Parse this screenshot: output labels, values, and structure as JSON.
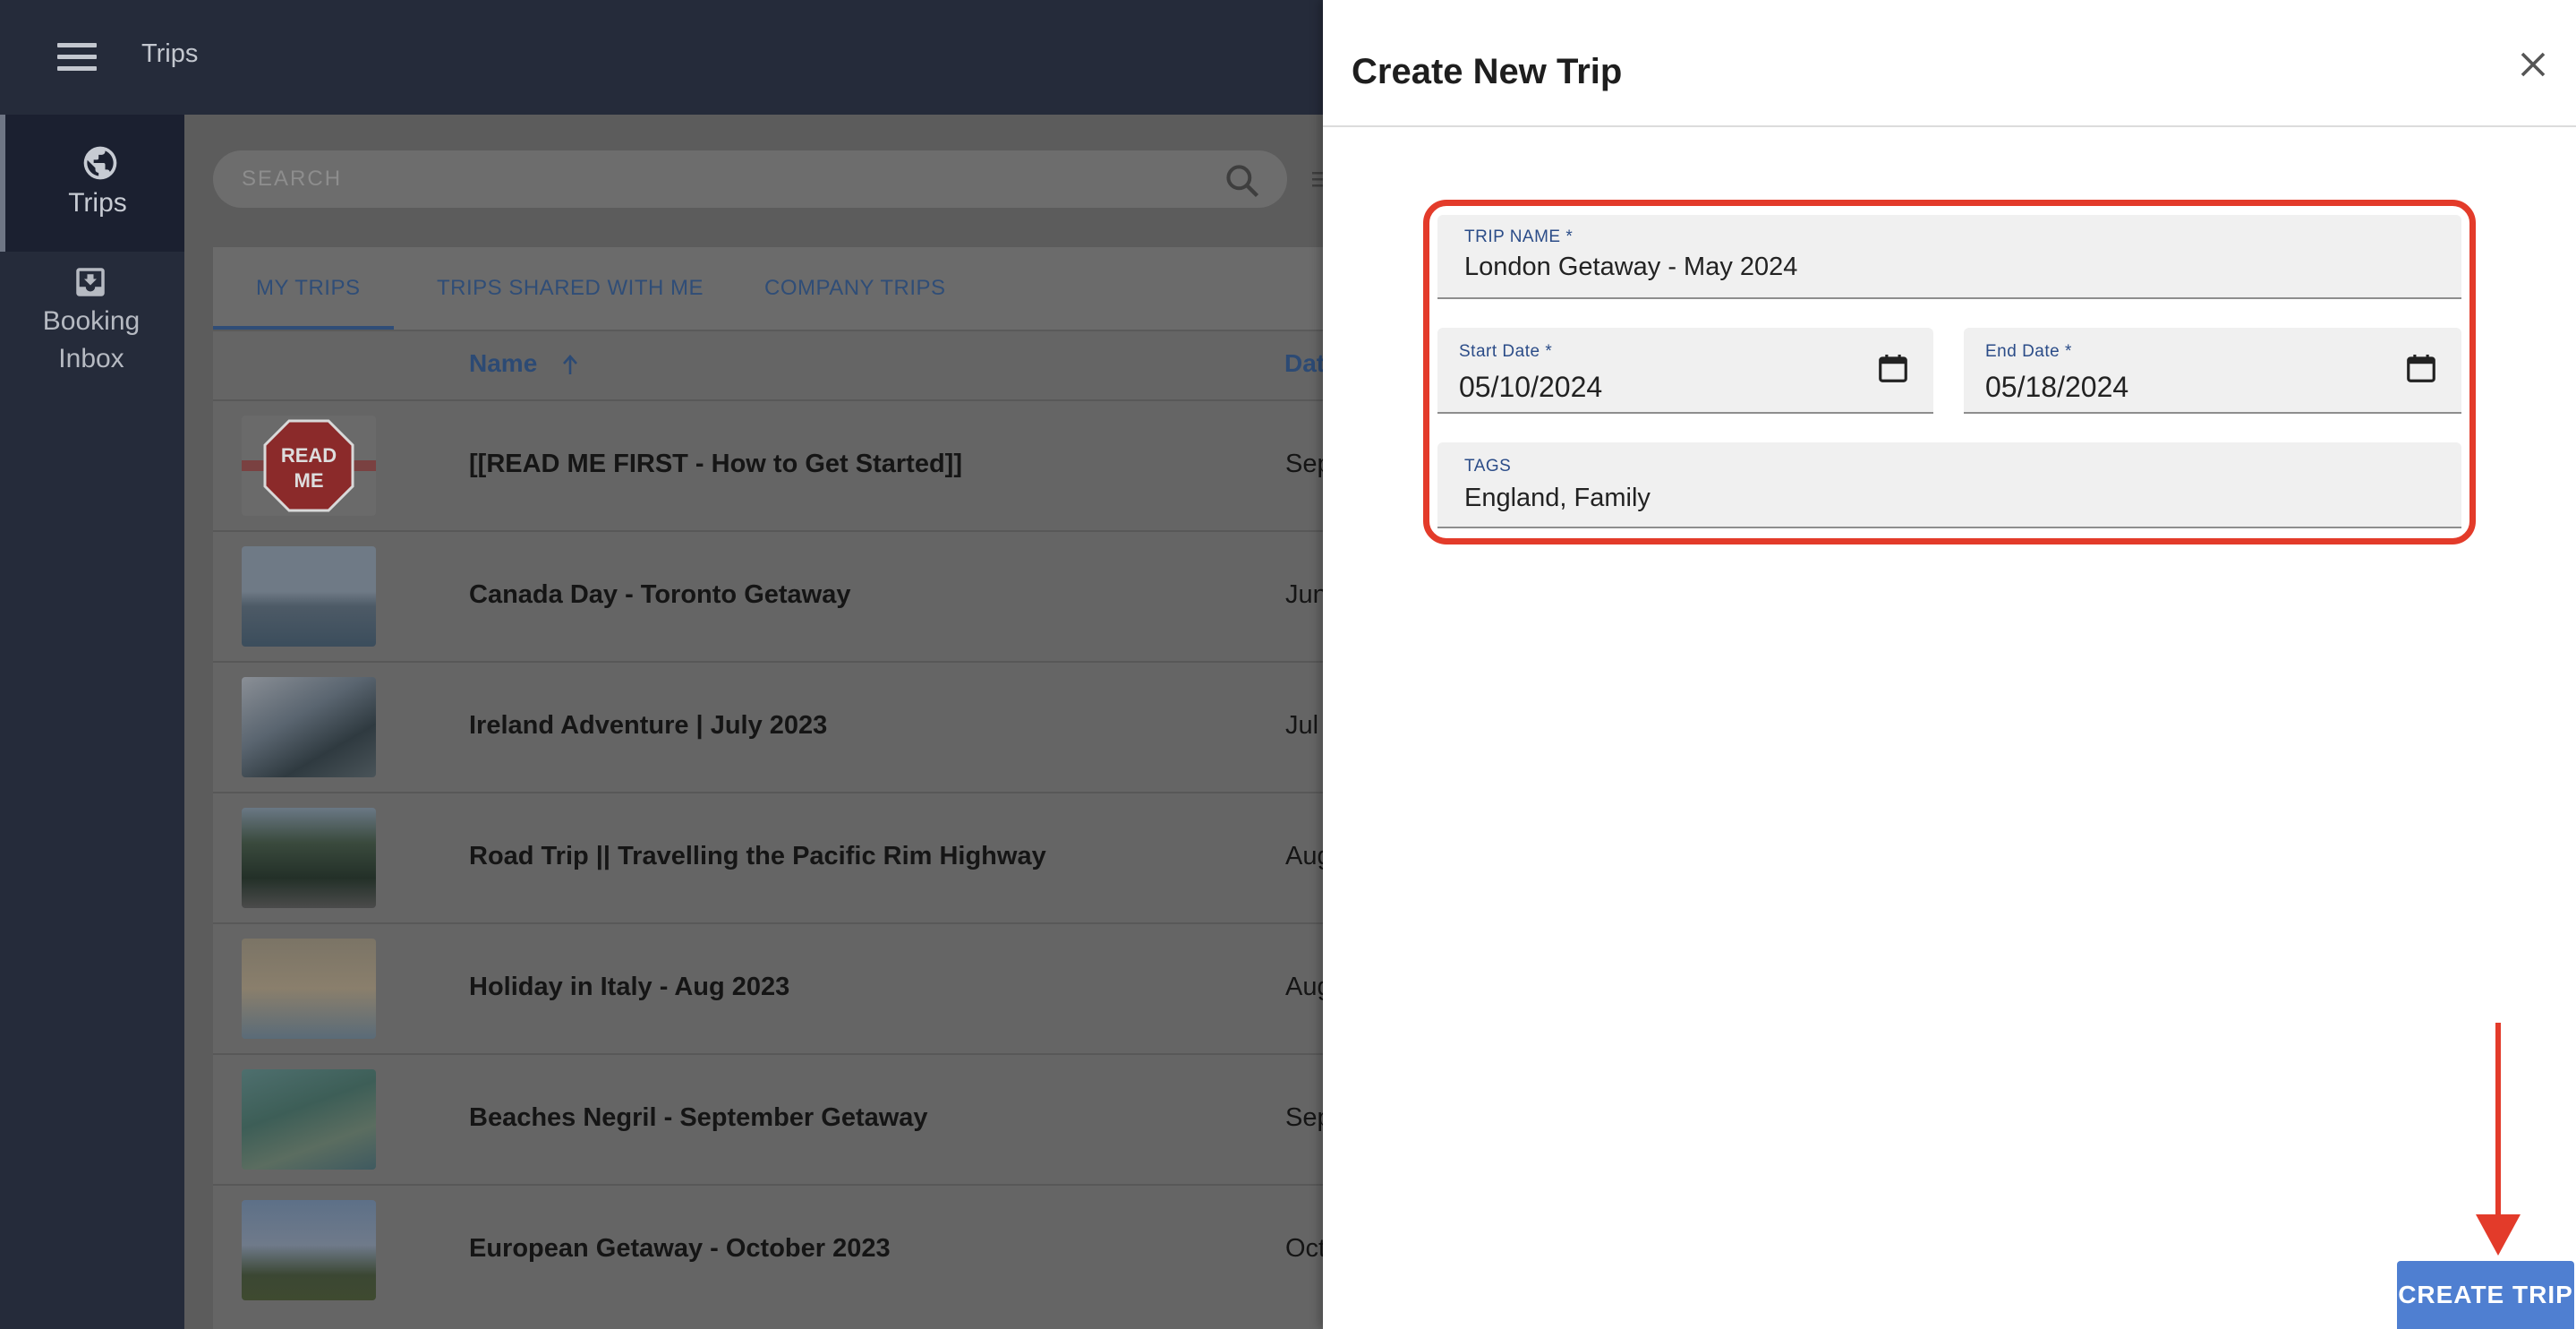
{
  "app": {
    "title": "Trips"
  },
  "sidebar": {
    "items": [
      {
        "label": "Trips",
        "icon": "globe-icon"
      },
      {
        "label": "Booking Inbox",
        "icon": "inbox-icon"
      }
    ]
  },
  "search": {
    "placeholder": "SEARCH"
  },
  "tabs": [
    {
      "label": "MY TRIPS",
      "active": true
    },
    {
      "label": "TRIPS SHARED WITH ME"
    },
    {
      "label": "COMPANY TRIPS"
    }
  ],
  "table": {
    "columns": [
      {
        "label": "Name"
      },
      {
        "label": "Dat"
      }
    ],
    "rows": [
      {
        "name": "[[READ ME FIRST - How to Get Started]]",
        "date": "Sep"
      },
      {
        "name": "Canada Day - Toronto Getaway",
        "date": "Jun"
      },
      {
        "name": "Ireland Adventure | July 2023",
        "date": "Jul"
      },
      {
        "name": "Road Trip || Travelling the Pacific Rim Highway",
        "date": "Aug"
      },
      {
        "name": "Holiday in Italy - Aug 2023",
        "date": "Aug"
      },
      {
        "name": "Beaches Negril - September Getaway",
        "date": "Sep"
      },
      {
        "name": "European Getaway - October 2023",
        "date": "Oct"
      }
    ]
  },
  "readme_badge": {
    "line1": "READ",
    "line2": "ME"
  },
  "drawer": {
    "title": "Create New Trip",
    "fields": {
      "trip_name": {
        "label": "TRIP NAME *",
        "value": "London Getaway - May 2024"
      },
      "start_date": {
        "label": "Start Date *",
        "value": "05/10/2024"
      },
      "end_date": {
        "label": "End Date *",
        "value": "05/18/2024"
      },
      "tags": {
        "label": "TAGS",
        "value": "England, Family"
      }
    },
    "submit_label": "CREATE TRIP"
  },
  "colors": {
    "sidebar": "#252b3a",
    "accent": "#4f7fd1",
    "annotation": "#e33b2a",
    "tab_text": "#2f4d77"
  }
}
